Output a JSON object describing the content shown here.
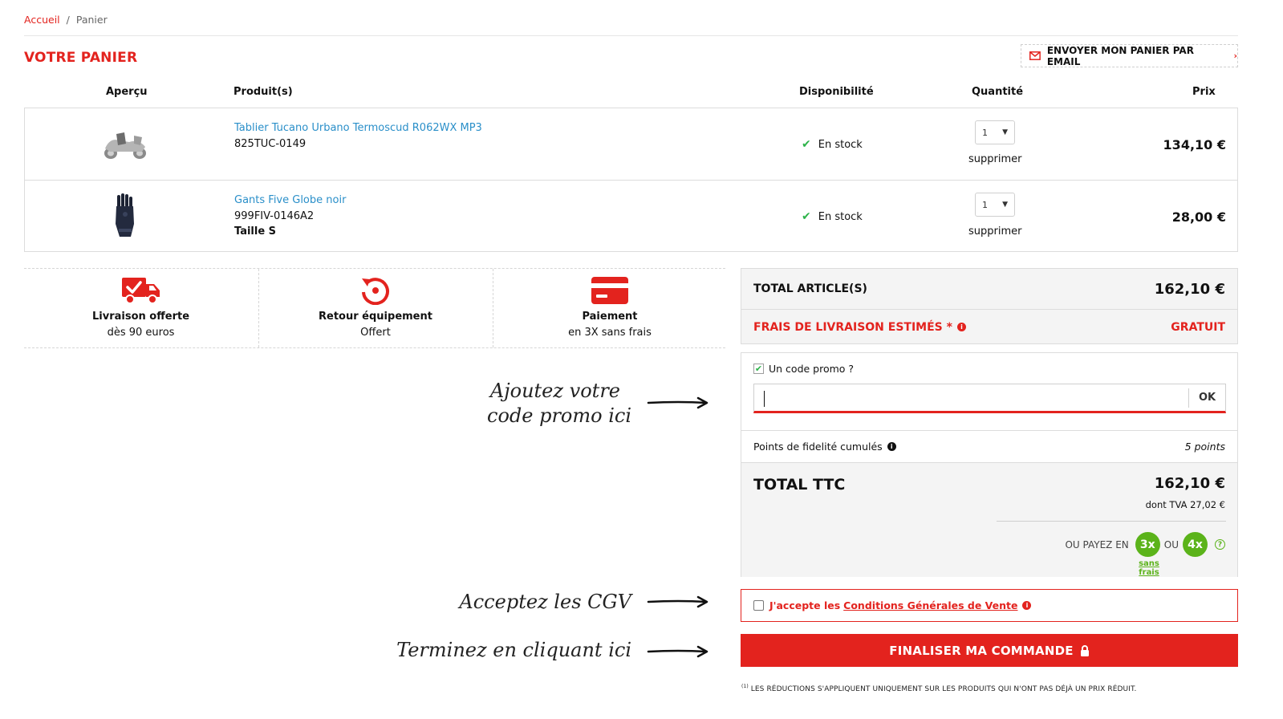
{
  "breadcrumb": {
    "home": "Accueil",
    "separator": "/",
    "current": "Panier"
  },
  "page_title": "VOTRE PANIER",
  "email_button": {
    "label": "ENVOYER MON PANIER PAR EMAIL",
    "icon": "envelope-icon"
  },
  "table_headers": {
    "preview": "Aperçu",
    "product": "Produit(s)",
    "availability": "Disponibilité",
    "quantity": "Quantité",
    "price": "Prix"
  },
  "items": [
    {
      "name": "Tablier Tucano Urbano Termoscud R062WX MP3",
      "ref": "825TUC-0149",
      "size": "",
      "stock": "En stock",
      "qty": "1",
      "remove": "supprimer",
      "price": "134,10 €",
      "image_icon": "scooter-apron-image"
    },
    {
      "name": "Gants Five Globe noir",
      "ref": "999FIV-0146A2",
      "size": "Taille S",
      "stock": "En stock",
      "qty": "1",
      "remove": "supprimer",
      "price": "28,00 €",
      "image_icon": "glove-image"
    }
  ],
  "reassurance": [
    {
      "icon": "delivery-truck-icon",
      "title": "Livraison offerte",
      "subtitle": "dès 90 euros"
    },
    {
      "icon": "return-icon",
      "title": "Retour équipement",
      "subtitle": "Offert"
    },
    {
      "icon": "credit-card-icon",
      "title": "Paiement",
      "subtitle": "en 3X sans frais"
    }
  ],
  "totals": {
    "articles_label": "TOTAL ARTICLE(S)",
    "articles_value": "162,10 €",
    "shipping_label": "FRAIS DE LIVRAISON ESTIMÉS *",
    "shipping_value": "GRATUIT"
  },
  "promo": {
    "label": "Un code promo ?",
    "value": "",
    "placeholder": "",
    "ok": "OK"
  },
  "points": {
    "label": "Points de fidelité cumulés",
    "value": "5 points"
  },
  "ttc": {
    "label": "TOTAL TTC",
    "value": "162,10 €",
    "tva": "dont TVA 27,02 €",
    "pay_prefix": "OU PAYEZ EN",
    "badge_3x": "3x",
    "pay_or": "OU",
    "badge_4x": "4x",
    "help": "?",
    "sans_frais": "sans frais"
  },
  "cgv": {
    "prefix": "J'accepte les",
    "link": "Conditions Générales de Vente"
  },
  "finalize": "FINALISER MA COMMANDE",
  "footnote": {
    "mark": "(1)",
    "text": "LES RÉDUCTIONS S'APPLIQUENT UNIQUEMENT SUR LES PRODUITS QUI N'ONT PAS DÉJÀ UN PRIX RÉDUIT."
  },
  "annotations": {
    "promo_line1": "Ajoutez votre",
    "promo_line2": "code promo ici",
    "cgv": "Acceptez les CGV",
    "finish": "Terminez en cliquant ici"
  },
  "colors": {
    "accent": "#e3231e",
    "link": "#2a8fc9",
    "success": "#2db34a",
    "pay_badge": "#5bb31a"
  }
}
